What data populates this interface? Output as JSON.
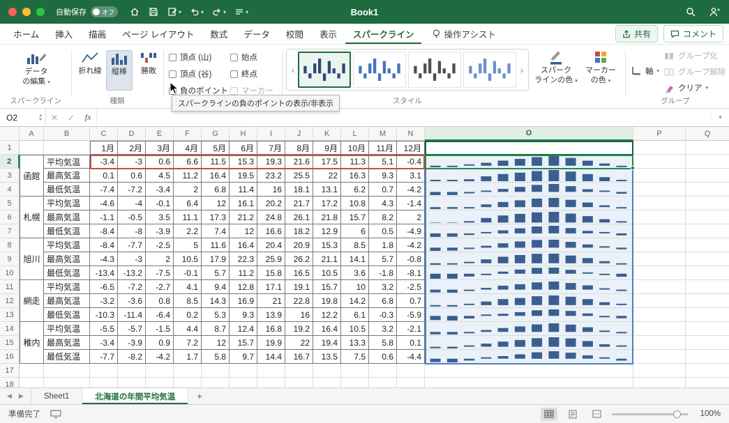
{
  "titlebar": {
    "autosave_label": "自動保存",
    "autosave_state": "オフ",
    "title": "Book1"
  },
  "icons": {
    "caret_down": "▾",
    "gallery_prev": "‹",
    "gallery_next": "›",
    "tab_prev": "◀",
    "tab_next": "▶",
    "add_sheet": "+",
    "cancel": "✕",
    "enter": "✓",
    "spin_up": "▲",
    "spin_down": "▼"
  },
  "ribbon_tabs": {
    "tabs": [
      "ホーム",
      "挿入",
      "描画",
      "ページ レイアウト",
      "数式",
      "データ",
      "校閲",
      "表示",
      "スパークライン"
    ],
    "active_tab": "スパークライン",
    "assist_label": "操作アシスト",
    "share_label": "共有",
    "comments_label": "コメント"
  },
  "ribbon": {
    "edit_data_line1": "データ",
    "edit_data_line2": "の編集",
    "group_sparkline_label": "スパークライン",
    "type": {
      "label": "種類",
      "line": "折れ線",
      "column": "縦棒",
      "winloss": "勝敗"
    },
    "checkboxes": {
      "high": "頂点 (山)",
      "low": "頂点 (谷)",
      "negative": "負のポイント",
      "first": "始点",
      "last": "終点",
      "markers": "マーカー"
    },
    "style_label": "スタイル",
    "style_gallery": {
      "pattern": [
        3,
        -2,
        4,
        6,
        -3,
        5,
        2,
        -2,
        4
      ],
      "colors": [
        "#2d4a77",
        "#4472c4",
        "#4d4d55",
        "#6e8fc9"
      ]
    },
    "sparkline_color_line1": "スパーク",
    "sparkline_color_line2": "ラインの色",
    "marker_color_line1": "マーカー",
    "marker_color_line2": "の色",
    "axis_label": "軸",
    "group_button_label": "グループ化",
    "ungroup_button_label": "グループ解除",
    "clear_button_label": "クリア",
    "group_section_label": "グループ",
    "tooltip": "スパークラインの負のポイントの表示/非表示"
  },
  "formula_bar": {
    "name_box": "O2",
    "fx": "fx"
  },
  "grid": {
    "visible_columns": [
      "A",
      "B",
      "C",
      "D",
      "E",
      "F",
      "G",
      "H",
      "I",
      "J",
      "K",
      "L",
      "M",
      "N",
      "O",
      "P",
      "Q"
    ],
    "visible_rows": 18,
    "selected_cell": "O2",
    "sparkline_color": "#3a5f8f",
    "months": [
      "1月",
      "2月",
      "3月",
      "4月",
      "5月",
      "6月",
      "7月",
      "8月",
      "9月",
      "10月",
      "11月",
      "12月"
    ],
    "row_labels": [
      "平均気温",
      "最高気温",
      "最低気温"
    ],
    "cities": [
      {
        "name": "函館",
        "rows": [
          [
            -3.4,
            -3,
            0.6,
            6.6,
            11.5,
            15.3,
            19.3,
            21.6,
            17.5,
            11.3,
            5.1,
            -0.4
          ],
          [
            0.1,
            0.6,
            4.5,
            11.2,
            16.4,
            19.5,
            23.2,
            25.5,
            22,
            16.3,
            9.3,
            3.1
          ],
          [
            -7.4,
            -7.2,
            -3.4,
            2,
            6.8,
            11.4,
            16,
            18.1,
            13.1,
            6.2,
            0.7,
            -4.2
          ]
        ]
      },
      {
        "name": "札幌",
        "rows": [
          [
            -4.6,
            -4,
            -0.1,
            6.4,
            12,
            16.1,
            20.2,
            21.7,
            17.2,
            10.8,
            4.3,
            -1.4
          ],
          [
            -1.1,
            -0.5,
            3.5,
            11.1,
            17.3,
            21.2,
            24.8,
            26.1,
            21.8,
            15.7,
            8.2,
            2
          ],
          [
            -8.4,
            -8,
            -3.9,
            2.2,
            7.4,
            12,
            16.6,
            18.2,
            12.9,
            6,
            0.5,
            -4.9
          ]
        ]
      },
      {
        "name": "旭川",
        "rows": [
          [
            -8.4,
            -7.7,
            -2.5,
            5,
            11.6,
            16.4,
            20.4,
            20.9,
            15.3,
            8.5,
            1.8,
            -4.2
          ],
          [
            -4.3,
            -3,
            2,
            10.5,
            17.9,
            22.3,
            25.9,
            26.2,
            21.1,
            14.1,
            5.7,
            -0.8
          ],
          [
            -13.4,
            -13.2,
            -7.5,
            -0.1,
            5.7,
            11.2,
            15.8,
            16.5,
            10.5,
            3.6,
            -1.8,
            -8.1
          ]
        ]
      },
      {
        "name": "網走",
        "rows": [
          [
            -6.5,
            -7.2,
            -2.7,
            4.1,
            9.4,
            12.8,
            17.1,
            19.1,
            15.7,
            10,
            3.2,
            -2.5
          ],
          [
            -3.2,
            -3.6,
            0.8,
            8.5,
            14.3,
            16.9,
            21,
            22.8,
            19.8,
            14.2,
            6.8,
            0.7
          ],
          [
            -10.3,
            -11.4,
            -6.4,
            0.2,
            5.3,
            9.3,
            13.9,
            16,
            12.2,
            6.1,
            -0.3,
            -5.9
          ]
        ]
      },
      {
        "name": "稚内",
        "rows": [
          [
            -5.5,
            -5.7,
            -1.5,
            4.4,
            8.7,
            12.4,
            16.8,
            19.2,
            16.4,
            10.5,
            3.2,
            -2.1
          ],
          [
            -3.4,
            -3.9,
            0.9,
            7.2,
            12,
            15.7,
            19.9,
            22,
            19.4,
            13.3,
            5.8,
            0.1
          ],
          [
            -7.7,
            -8.2,
            -4.2,
            1.7,
            5.8,
            9.7,
            14.4,
            16.7,
            13.5,
            7.5,
            0.6,
            -4.4
          ]
        ]
      }
    ]
  },
  "sheet_bar": {
    "tabs": [
      "Sheet1",
      "北海道の年間平均気温"
    ],
    "active_tab": "北海道の年間平均気温"
  },
  "status_bar": {
    "ready_label": "準備完了",
    "zoom": "100%"
  }
}
